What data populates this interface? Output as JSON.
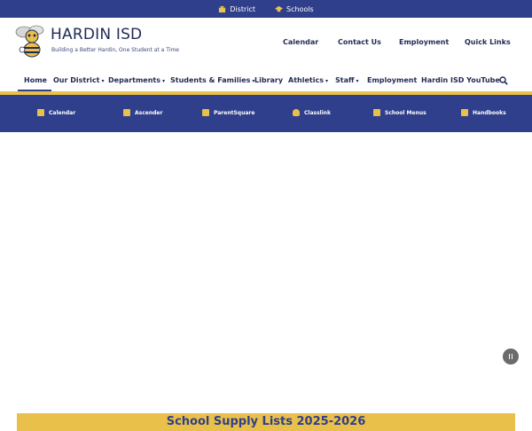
{
  "topbar": {
    "items": [
      {
        "label": "District",
        "icon": "building-icon"
      },
      {
        "label": "Schools",
        "icon": "graduation-cap-icon"
      }
    ]
  },
  "brand": {
    "title": "HARDIN ISD",
    "tagline": "Building a Better Hardin, One Student at a Time",
    "logo": "hornet-mascot-logo"
  },
  "quick_links": [
    "Calendar",
    "Contact Us",
    "Employment",
    "Quick Links"
  ],
  "main_nav": {
    "items": [
      {
        "label": "Home",
        "dropdown": false,
        "active": true
      },
      {
        "label": "Our District",
        "dropdown": true
      },
      {
        "label": "Departments",
        "dropdown": true
      },
      {
        "label": "Students & Families",
        "dropdown": true
      },
      {
        "label": "Library",
        "dropdown": false
      },
      {
        "label": "Athletics",
        "dropdown": true
      },
      {
        "label": "Staff",
        "dropdown": true
      },
      {
        "label": "Employment",
        "dropdown": false
      },
      {
        "label": "Hardin ISD YouTube",
        "dropdown": false
      }
    ],
    "search_icon": "search-icon"
  },
  "icon_bar": {
    "items": [
      {
        "label": "Calendar",
        "icon": "calendar-icon"
      },
      {
        "label": "Ascender",
        "icon": "ascender-icon"
      },
      {
        "label": "ParentSquare",
        "icon": "parentsquare-icon"
      },
      {
        "label": "Classlink",
        "icon": "cloud-icon"
      },
      {
        "label": "School Menus",
        "icon": "utensils-icon"
      },
      {
        "label": "Handbooks",
        "icon": "book-icon"
      }
    ]
  },
  "slider": {
    "pause_icon": "pause-icon"
  },
  "announcement": {
    "title": "School Supply Lists 2025-2026"
  },
  "colors": {
    "navy": "#2f3f8c",
    "gold": "#e8c04a",
    "text": "#1f2a55"
  }
}
